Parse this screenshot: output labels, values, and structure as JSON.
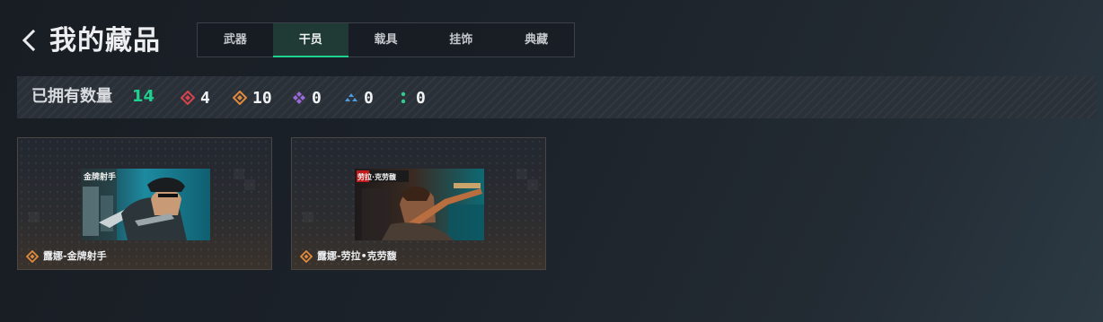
{
  "header": {
    "back_icon": "chevron-left-icon",
    "title": "我的藏品"
  },
  "tabs": [
    {
      "label": "武器",
      "active": false
    },
    {
      "label": "干员",
      "active": true
    },
    {
      "label": "载具",
      "active": false
    },
    {
      "label": "挂饰",
      "active": false
    },
    {
      "label": "典藏",
      "active": false
    }
  ],
  "stats": {
    "owned_label": "已拥有数量",
    "owned_count": "14",
    "rarities": [
      {
        "icon": "red-diamond-icon",
        "color": "#d8434b",
        "count": "4"
      },
      {
        "icon": "orange-diamond-icon",
        "color": "#e08a3c",
        "count": "10"
      },
      {
        "icon": "purple-diamond-icon",
        "color": "#9a6ad8",
        "count": "0"
      },
      {
        "icon": "blue-triangle-icon",
        "color": "#4f9be0",
        "count": "0"
      },
      {
        "icon": "green-dots-icon",
        "color": "#2fce8c",
        "count": "0"
      }
    ]
  },
  "cards": [
    {
      "name": "露娜-金牌射手",
      "rarity_icon": "orange-diamond-icon",
      "rarity_color": "#e08a3c",
      "image_text": "金牌射手"
    },
    {
      "name": "露娜-劳拉•克劳馥",
      "rarity_icon": "orange-diamond-icon",
      "rarity_color": "#e08a3c",
      "image_text": "劳拉·克劳馥"
    }
  ],
  "colors": {
    "accent": "#1fd18e",
    "background": "#1c222a"
  }
}
